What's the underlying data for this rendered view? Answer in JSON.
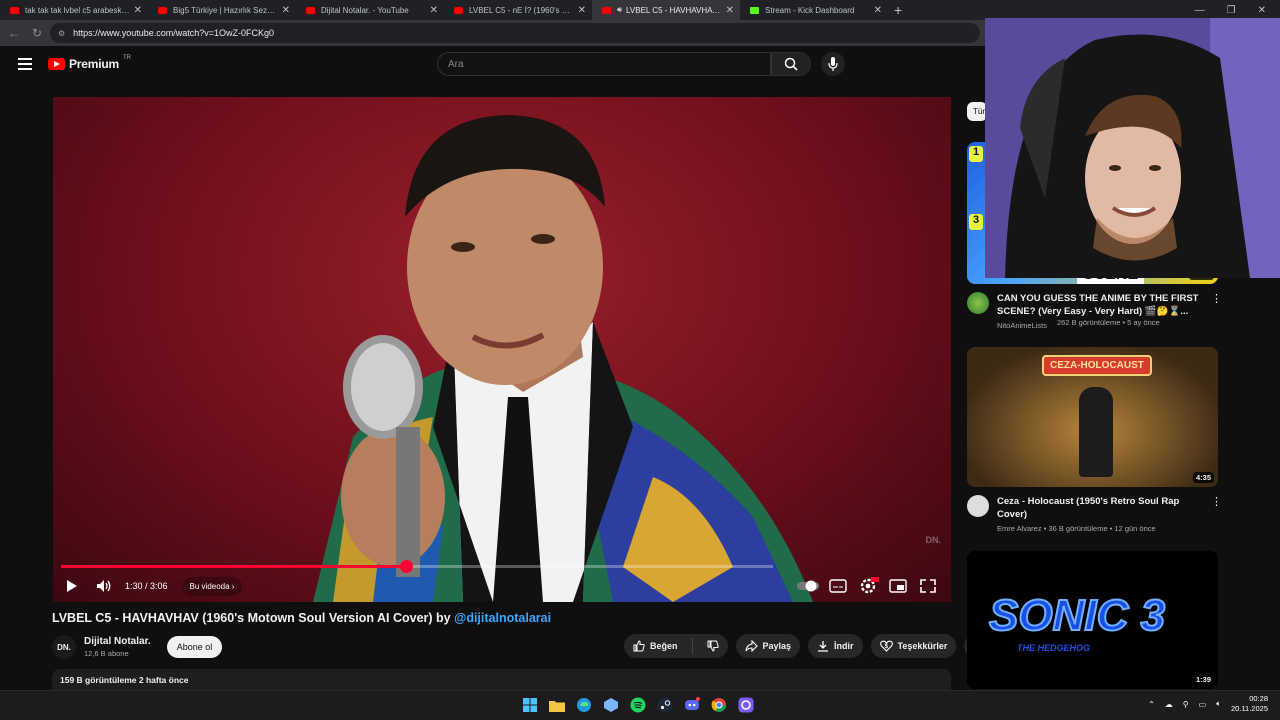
{
  "browser": {
    "tabs": [
      {
        "title": "tak tak tak lvbel c5 arabesk - YouT",
        "icon": "youtube-icon",
        "active": false
      },
      {
        "title": "Big5 Türkiye | Hazırlık Sezonu 9. B",
        "icon": "youtube-icon",
        "active": false
      },
      {
        "title": "Dijital Notalar. - YouTube",
        "icon": "youtube-icon",
        "active": false
      },
      {
        "title": "LVBEL C5 - nE İ? (1960's Motown",
        "icon": "youtube-icon",
        "active": false
      },
      {
        "title": "LVBEL C5 - HAVHAVHAV (1960",
        "icon": "youtube-icon",
        "active": true
      },
      {
        "title": "Stream - Kick Dashboard",
        "icon": "kick-icon",
        "active": false
      }
    ],
    "url": "https://www.youtube.com/watch?v=1OwZ-0FCKg0"
  },
  "header": {
    "logo_text": "Premium",
    "country": "TR",
    "search_placeholder": "Ara"
  },
  "player": {
    "time": "1:30 / 3:06",
    "chapter_label": "Bu videoda",
    "progress": 0.484,
    "watermark": "DN."
  },
  "video": {
    "title": "LVBEL C5 - HAVHAVHAV (1960's Motown Soul Version AI Cover) by ",
    "title_handle": "@dijitalnotalarai",
    "channel_name": "Dijital Notalar.",
    "channel_avatar": "DN.",
    "subscribers": "12,6 B abone",
    "subscribe_label": "Abone ol",
    "like_label": "Beğen",
    "share_label": "Paylaş",
    "download_label": "İndir",
    "thanks_label": "Teşekkürler",
    "views_date": "159 B görüntüleme  2 hafta önce"
  },
  "sidebar": {
    "chip_label": "Tümü",
    "recommendations": [
      {
        "title": "CAN YOU GUESS THE ANIME BY THE FIRST SCENE? (Very Easy - Very Hard) 🎬🤔⌛...",
        "channel": "NitoAnimeLists",
        "stats": "262 B görüntüleme • 5 ay önce",
        "duration": "32:15",
        "thumb_text": "SCENE"
      },
      {
        "title": "Ceza - Holocaust (1950's Retro Soul Rap Cover)",
        "channel": "Emre Alvarez",
        "stats": "36 B görüntüleme • 12 gün önce",
        "duration": "4:35",
        "thumb_text": "CEZA-HOLOCAUST"
      },
      {
        "title": "",
        "channel": "",
        "stats": "",
        "duration": "1:39",
        "thumb_text": "SONIC 3",
        "thumb_sub": "THE HEDGEHOG"
      }
    ]
  },
  "taskbar": {
    "time": "00:28",
    "date": "20.11.2025"
  },
  "colors": {
    "youtube_red": "#ff0000",
    "progress_red": "#ff0033",
    "link_blue": "#3ea6ff",
    "kick_green": "#53fc18"
  }
}
